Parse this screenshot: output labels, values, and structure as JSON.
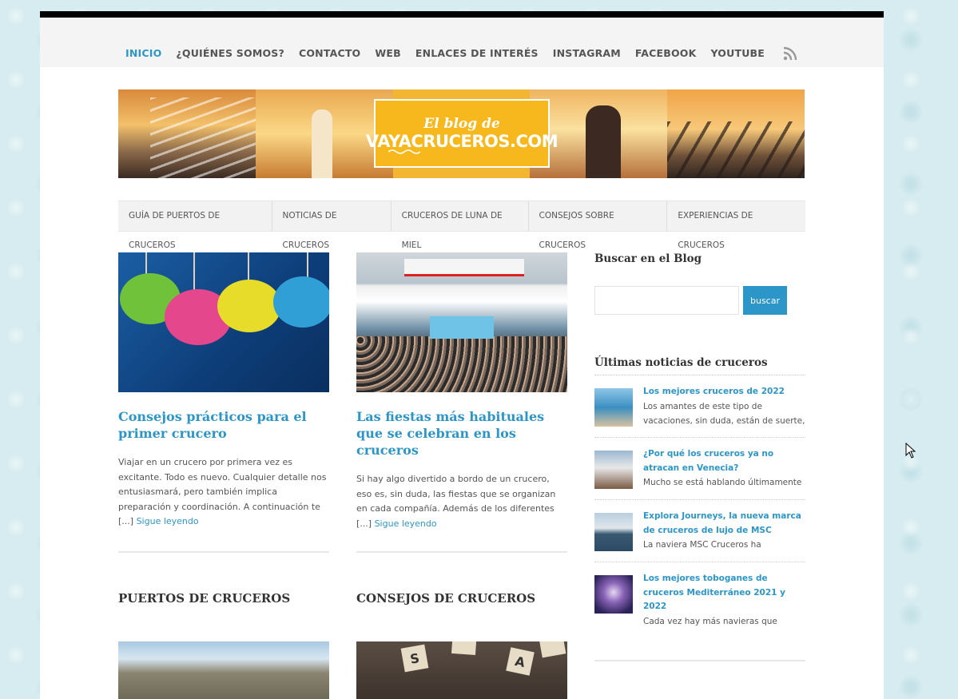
{
  "topnav": {
    "items": [
      "INICIO",
      "¿QUIÉNES SOMOS?",
      "CONTACTO",
      "WEB",
      "ENLACES DE INTERÉS",
      "INSTAGRAM",
      "FACEBOOK",
      "YOUTUBE"
    ],
    "active_index": 0
  },
  "banner": {
    "logo_top": "El blog de",
    "logo_main": "VAYACRUCEROS.COM"
  },
  "catnav": {
    "items": [
      "GUÍA DE PUERTOS DE CRUCEROS",
      "NOTICIAS DE CRUCEROS",
      "CRUCEROS DE LUNA DE MIEL",
      "CONSEJOS SOBRE CRUCEROS",
      "EXPERIENCIAS DE CRUCEROS"
    ]
  },
  "posts": [
    {
      "title": "Consejos prácticos para el primer crucero",
      "excerpt": "Viajar en un crucero por primera vez es excitante. Todo es nuevo. Cualquier detalle nos entusiasmará, pero también implica preparación y coordinación. A continuación te [...]",
      "more": "Sigue leyendo"
    },
    {
      "title": "Las fiestas más habituales que se celebran en los cruceros",
      "excerpt": "Si hay algo divertido a bordo de un crucero, eso es, sin duda, las fiestas que se organizan en cada compañía. Además de los diferentes [...]",
      "more": "Sigue leyendo"
    }
  ],
  "sections": {
    "left": "PUERTOS DE CRUCEROS",
    "right": "CONSEJOS DE CRUCEROS"
  },
  "tiles": [
    "S",
    "A"
  ],
  "sidebar": {
    "search_title": "Buscar en el Blog",
    "search_placeholder": "",
    "search_button": "buscar",
    "news_title": "Últimas noticias de cruceros",
    "news": [
      {
        "title": "Los mejores cruceros de 2022",
        "desc": "Los amantes de este tipo de vacaciones, sin duda, están de suerte,"
      },
      {
        "title": "¿Por qué los cruceros ya no atracan en Venecia?",
        "desc": "Mucho se está hablando últimamente"
      },
      {
        "title": "Explora Journeys, la nueva marca de cruceros de lujo de MSC",
        "desc": "La naviera MSC Cruceros ha"
      },
      {
        "title": "Los mejores toboganes de cruceros Mediterráneo 2021 y 2022",
        "desc": "Cada vez hay más navieras que"
      }
    ]
  },
  "colors": {
    "accent": "#2d96c8",
    "logo_yellow": "#f7b81d",
    "text": "#555555"
  },
  "icons": [
    "rss-icon",
    "mouse-cursor-icon"
  ]
}
